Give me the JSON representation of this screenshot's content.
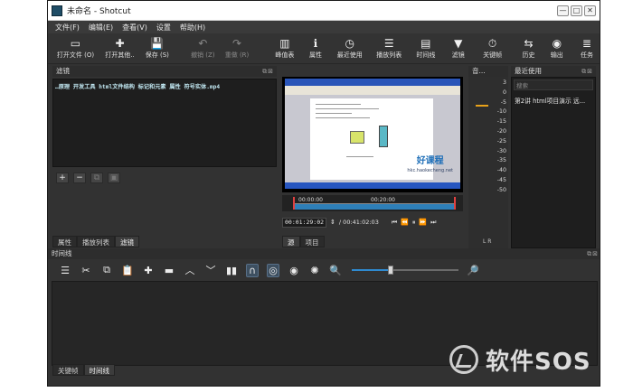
{
  "window": {
    "title": "未命名 - Shotcut",
    "controls": {
      "minimize": "—",
      "maximize": "□",
      "close": "✕"
    }
  },
  "menu": [
    "文件(F)",
    "编辑(E)",
    "查看(V)",
    "设置",
    "帮助(H)"
  ],
  "toolbar": [
    {
      "label": "打开文件 (O)",
      "icon": "open-file-icon",
      "glyph": "▭",
      "enabled": true
    },
    {
      "label": "打开其他..",
      "icon": "open-other-icon",
      "glyph": "✚",
      "enabled": true
    },
    {
      "label": "保存 (S)",
      "icon": "save-icon",
      "glyph": "💾",
      "enabled": true
    },
    {
      "label": "撤销 (Z)",
      "icon": "undo-icon",
      "glyph": "↶",
      "enabled": false
    },
    {
      "label": "重做 (R)",
      "icon": "redo-icon",
      "glyph": "↷",
      "enabled": false
    },
    {
      "label": "峰值表",
      "icon": "peak-meter-icon",
      "glyph": "▥",
      "enabled": true
    },
    {
      "label": "属性",
      "icon": "properties-icon",
      "glyph": "ℹ",
      "enabled": true
    },
    {
      "label": "最近使用",
      "icon": "recent-icon",
      "glyph": "◷",
      "enabled": true
    },
    {
      "label": "播放列表",
      "icon": "playlist-icon",
      "glyph": "☰",
      "enabled": true
    },
    {
      "label": "时间线",
      "icon": "timeline-icon",
      "glyph": "▤",
      "enabled": true
    },
    {
      "label": "滤镜",
      "icon": "filter-icon",
      "glyph": "▼",
      "enabled": true
    },
    {
      "label": "关键帧",
      "icon": "keyframes-icon",
      "glyph": "⏱",
      "enabled": true
    },
    {
      "label": "历史",
      "icon": "history-icon",
      "glyph": "⇆",
      "enabled": true
    },
    {
      "label": "输出",
      "icon": "export-icon",
      "glyph": "◉",
      "enabled": true
    },
    {
      "label": "任务",
      "icon": "jobs-icon",
      "glyph": "≣",
      "enabled": true
    }
  ],
  "filters": {
    "title": "滤镜",
    "clip_name": "…原理 开发工具 html文件结构 标记和元素 属性 符号实体.mp4",
    "buttons": {
      "add": "+",
      "remove": "−",
      "copy": "⧉",
      "paste": "▣"
    }
  },
  "left_tabs": [
    "属性",
    "播放列表",
    "滤镜"
  ],
  "player": {
    "watermark_title": "好课程",
    "watermark_url": "hkc.haokecheng.net",
    "ruler_start": "00:00:00",
    "ruler_mid": "00:20:00",
    "current_timecode": "00:01:29:02",
    "duration": "/ 00:41:02:03",
    "transport": [
      "⏮",
      "⏪",
      "⏸",
      "⏩",
      "⏭"
    ],
    "tabs": [
      "源",
      "项目"
    ],
    "played_fraction": 1.0
  },
  "meter": {
    "title": "音...",
    "scale": [
      "3",
      "0",
      "-5",
      "-10",
      "-15",
      "-20",
      "-25",
      "-30",
      "-35",
      "-40",
      "-45",
      "-50"
    ],
    "footer": "L  R",
    "level_color": "#e8a21a"
  },
  "recent": {
    "title": "最近使用",
    "search_placeholder": "搜索",
    "items": [
      "第2讲 html项目演示 远..."
    ]
  },
  "timeline": {
    "title": "时间线",
    "tools": [
      {
        "name": "timeline-menu-icon",
        "glyph": "☰"
      },
      {
        "name": "cut-icon",
        "glyph": "✂"
      },
      {
        "name": "copy-icon",
        "glyph": "⧉"
      },
      {
        "name": "paste-icon",
        "glyph": "📋"
      },
      {
        "name": "append-icon",
        "glyph": "✚"
      },
      {
        "name": "remove-icon",
        "glyph": "▬"
      },
      {
        "name": "lift-icon",
        "glyph": "︿"
      },
      {
        "name": "overwrite-icon",
        "glyph": "﹀"
      },
      {
        "name": "split-icon",
        "glyph": "▮▮"
      },
      {
        "name": "snap-icon",
        "glyph": "∩"
      },
      {
        "name": "scrub-icon",
        "glyph": "◎"
      },
      {
        "name": "ripple-icon",
        "glyph": "◉"
      },
      {
        "name": "ripple-all-icon",
        "glyph": "✺"
      },
      {
        "name": "zoom-out-icon",
        "glyph": "🔍"
      },
      {
        "name": "zoom-in-icon",
        "glyph": "🔎"
      }
    ],
    "zoom_fraction": 0.34,
    "bottom_tabs": [
      "关键帧",
      "时间线"
    ]
  },
  "brand": {
    "text": "软件SOS"
  }
}
